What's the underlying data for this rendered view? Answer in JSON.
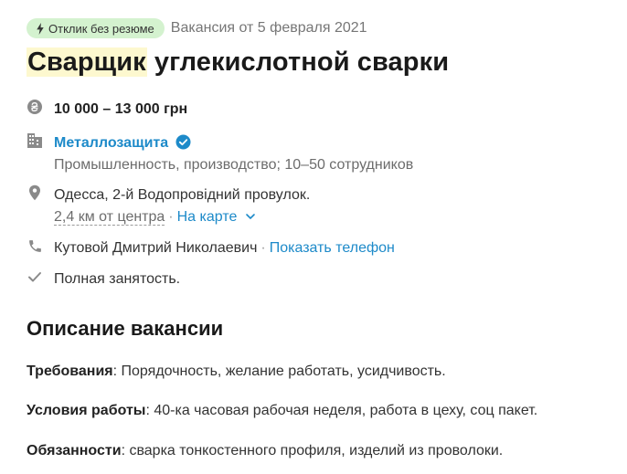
{
  "header": {
    "badge_label": "Отклик без резюме",
    "posted": "Вакансия от 5 февраля 2021"
  },
  "title": {
    "highlight": "Сварщик",
    "rest": " углекислотной сварки"
  },
  "salary": "10 000 – 13 000 грн",
  "company": {
    "name": "Металлозащита",
    "details": "Промышленность, производство; 10–50 сотрудников"
  },
  "address": {
    "line": "Одесса, 2-й Водопровідний провулок.",
    "distance": "2,4 км от центра",
    "separator": "·",
    "map_link": "На карте"
  },
  "contact": {
    "name": "Кутовой Дмитрий Николаевич",
    "separator": "·",
    "phone_link": "Показать телефон"
  },
  "employment": "Полная занятость.",
  "description": {
    "heading": "Описание вакансии",
    "requirements_label": "Требования",
    "requirements_text": ": Порядочность, желание работать, усидчивость.",
    "conditions_label": "Условия работы",
    "conditions_text": ": 40-ка часовая рабочая неделя, работа в цеху, соц пакет.",
    "duties_label": "Обязанности",
    "duties_text": ": сварка тонкостенного профиля, изделий из проволоки."
  },
  "colors": {
    "badge_bg": "#d4f2cf",
    "title_highlight": "#fdf8cf",
    "link": "#1d8ac9",
    "icon": "#8a8a8a",
    "verified": "#1d8ac9"
  }
}
